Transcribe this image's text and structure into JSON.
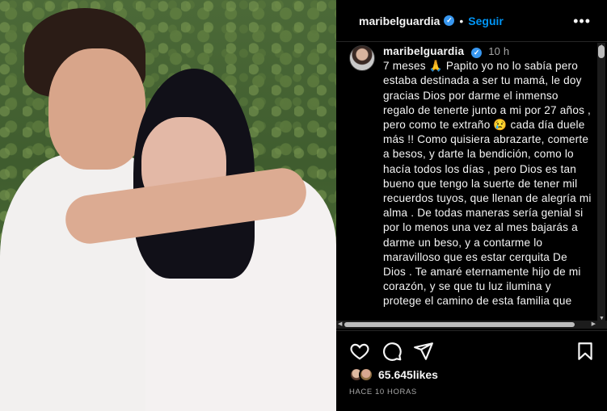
{
  "header": {
    "username": "maribelguardia",
    "verified_mark": "✓",
    "separator": "•",
    "follow_label": "Seguir",
    "more_label": "•••"
  },
  "caption": {
    "username": "maribelguardia",
    "time": "10 h",
    "text": "7 meses 🙏 Papito yo no lo sabía pero estaba destinada a ser tu mamá, le doy gracias Dios por darme el inmenso regalo de tenerte junto a mi por 27 años , pero como te extraño 😢 cada día duele más !! Como quisiera abrazarte, comerte a besos, y darte la bendición, como lo hacía todos los días , pero Dios es tan bueno que tengo la suerte de tener mil recuerdos tuyos, que llenan de alegría mi alma . De todas maneras sería genial si por lo menos una vez al mes bajarás a darme un beso, y a contarme lo maravilloso que es estar cerquita De Dios . Te amaré eternamente hijo de mi corazón, y se que tu luz ilumina y protege el camino de esta familia que"
  },
  "icons": {
    "like": "heart-icon",
    "comment": "comment-icon",
    "share": "send-icon",
    "save": "bookmark-icon",
    "more": "ellipsis-icon",
    "verified": "verified-badge-icon"
  },
  "likes": {
    "count_text": "65.645likes"
  },
  "timestamp": {
    "label": "HACE 10 HORAS"
  },
  "colors": {
    "background": "#000000",
    "text": "#f5f5f5",
    "secondary_text": "#a8a8a8",
    "follow_blue": "#0095f6",
    "verified_blue": "#3897f0",
    "divider": "#262626"
  }
}
